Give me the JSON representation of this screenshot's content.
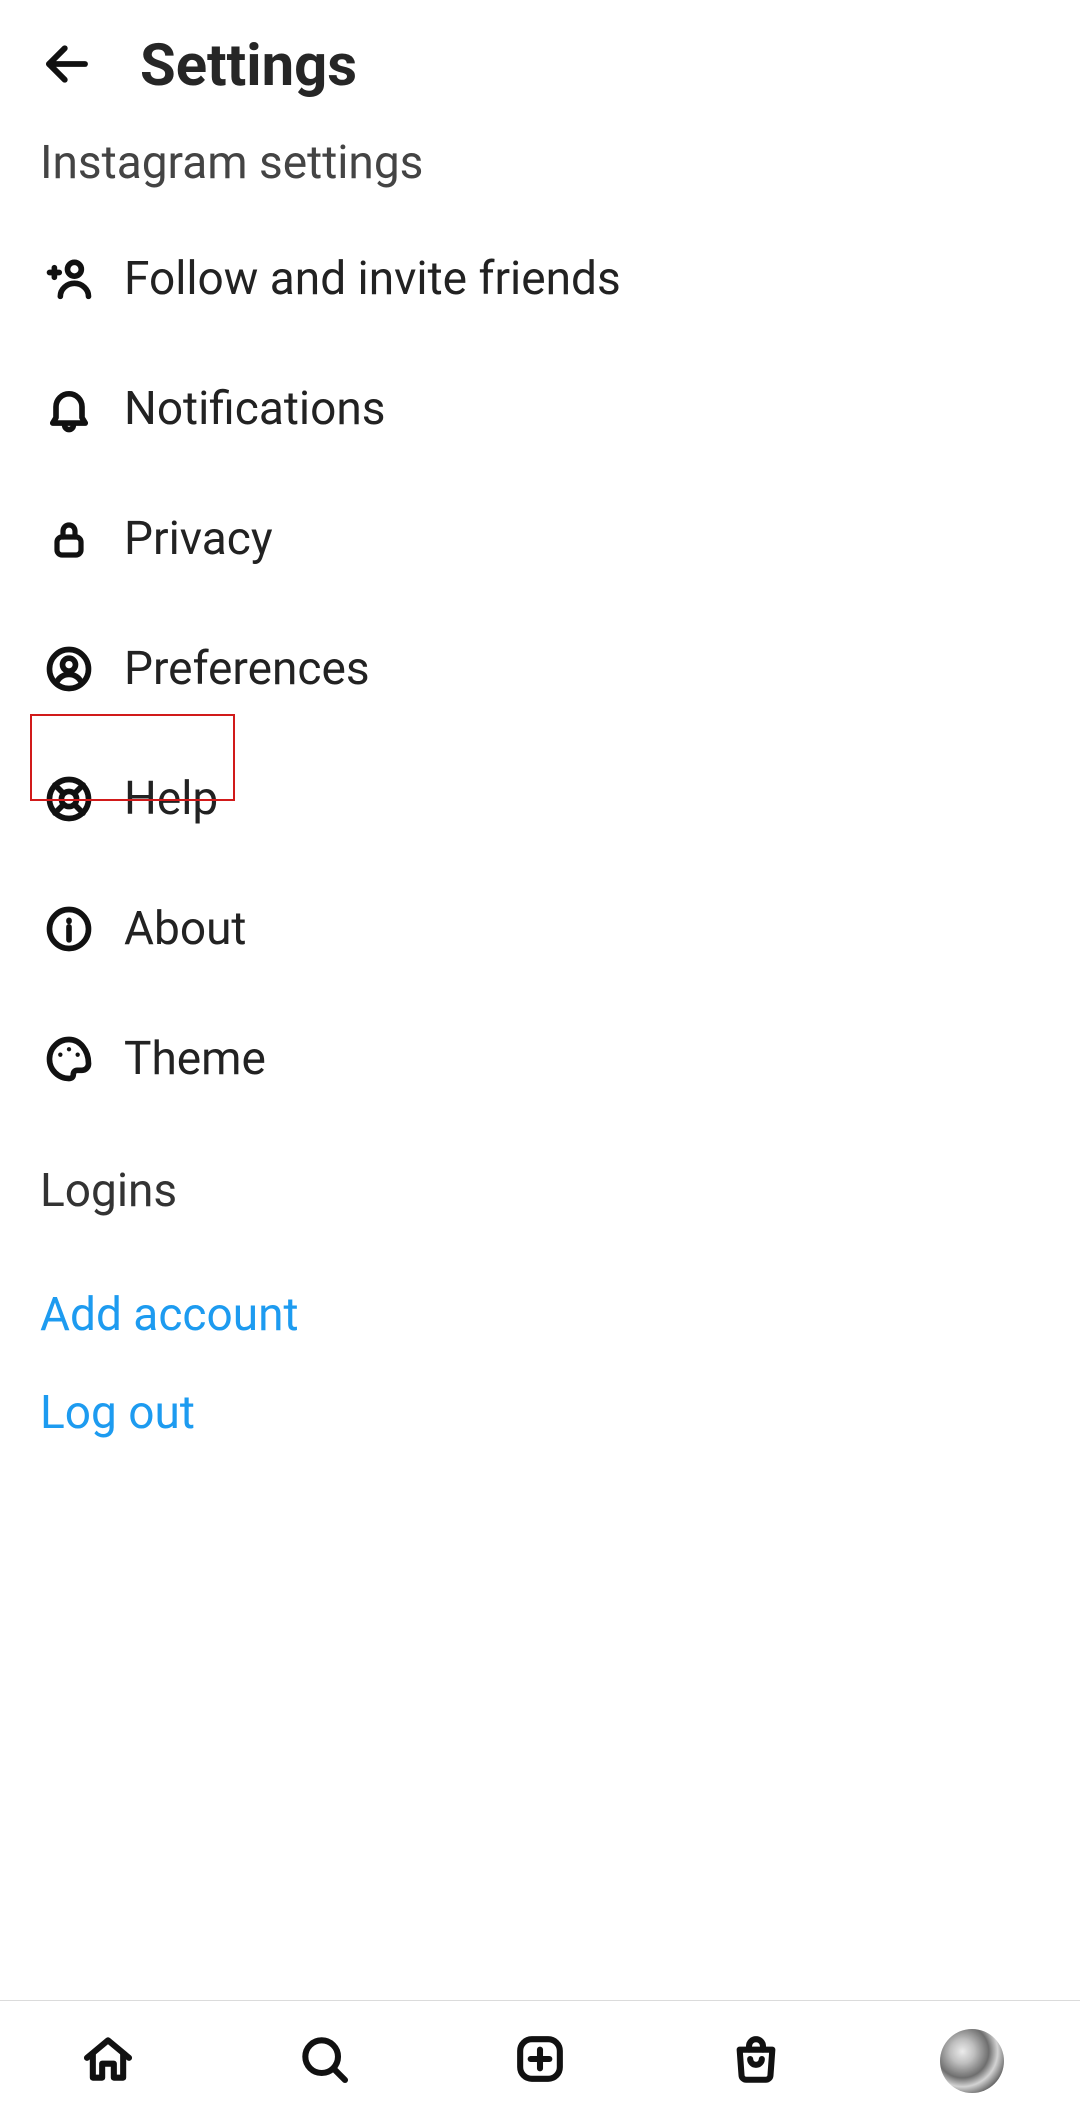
{
  "header": {
    "title": "Settings"
  },
  "sections": {
    "instagram_settings_label": "Instagram settings",
    "logins_label": "Logins"
  },
  "menu": {
    "items": [
      {
        "label": "Follow and invite friends",
        "icon": "add-person-icon"
      },
      {
        "label": "Notifications",
        "icon": "bell-icon"
      },
      {
        "label": "Privacy",
        "icon": "lock-icon"
      },
      {
        "label": "Preferences",
        "icon": "person-circle-icon"
      },
      {
        "label": "Help",
        "icon": "lifebuoy-icon"
      },
      {
        "label": "About",
        "icon": "info-icon"
      },
      {
        "label": "Theme",
        "icon": "palette-icon"
      }
    ]
  },
  "logins": {
    "add_account": "Add account",
    "log_out": "Log out"
  },
  "nav": {
    "home": "home-icon",
    "search": "search-icon",
    "create": "plus-square-icon",
    "shop": "shopping-bag-icon",
    "profile": "avatar"
  },
  "colors": {
    "link": "#1d9bf0",
    "highlight_border": "#d11a1a"
  }
}
